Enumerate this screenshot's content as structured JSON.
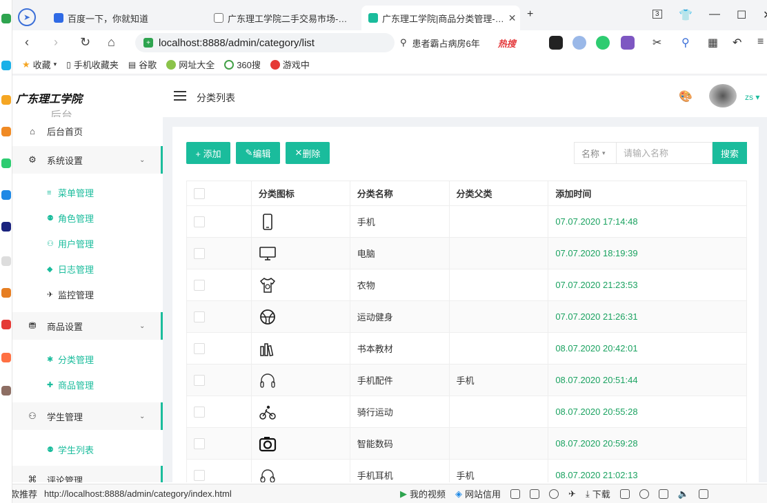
{
  "browser": {
    "tabs": [
      {
        "label": "百度一下，你就知道"
      },
      {
        "label": "广东理工学院二手交易市场-…"
      },
      {
        "label": "广东理工学院|商品分类管理-…"
      }
    ],
    "tab_count_badge": "3",
    "url": "localhost:8888/admin/category/list",
    "search_text": "患者霸占病房6年",
    "search_hot": "热搜",
    "bookmarks": [
      {
        "label": "收藏"
      },
      {
        "label": "手机收藏夹"
      },
      {
        "label": "谷歌"
      },
      {
        "label": "网址大全"
      },
      {
        "label": "360搜"
      },
      {
        "label": "游戏中"
      }
    ]
  },
  "header": {
    "logo": "广东理工学院",
    "logo_sub": "后台管理系统",
    "breadcrumb": "分类列表",
    "username": "zs"
  },
  "sidebar": {
    "menus": [
      {
        "label": "后台首页",
        "icon": "home-icon"
      },
      {
        "label": "系统设置",
        "icon": "gear-icon",
        "subs": [
          {
            "label": "菜单管理"
          },
          {
            "label": "角色管理"
          },
          {
            "label": "用户管理"
          },
          {
            "label": "日志管理"
          },
          {
            "label": "监控管理"
          }
        ]
      },
      {
        "label": "商品设置",
        "icon": "basket-icon",
        "subs": [
          {
            "label": "分类管理"
          },
          {
            "label": "商品管理"
          }
        ]
      },
      {
        "label": "学生管理",
        "icon": "users-icon",
        "subs": [
          {
            "label": "学生列表"
          }
        ]
      },
      {
        "label": "评论管理",
        "icon": "comment-icon"
      }
    ]
  },
  "toolbar": {
    "add_label": "+ 添加",
    "edit_label": "编辑",
    "delete_label": "删除",
    "filter_label": "名称",
    "search_placeholder": "请输入名称",
    "search_button": "搜索"
  },
  "table": {
    "headers": [
      "分类图标",
      "分类名称",
      "分类父类",
      "添加时间"
    ],
    "rows": [
      {
        "icon": "phone-icon",
        "name": "手机",
        "parent": "",
        "time": "07.07.2020 17:14:48"
      },
      {
        "icon": "monitor-icon",
        "name": "电脑",
        "parent": "",
        "time": "07.07.2020 18:19:39"
      },
      {
        "icon": "shirt-icon",
        "name": "衣物",
        "parent": "",
        "time": "07.07.2020 21:23:53"
      },
      {
        "icon": "ball-icon",
        "name": "运动健身",
        "parent": "",
        "time": "07.07.2020 21:26:31"
      },
      {
        "icon": "books-icon",
        "name": "书本教材",
        "parent": "",
        "time": "08.07.2020 20:42:01"
      },
      {
        "icon": "headphones-icon",
        "name": "手机配件",
        "parent": "手机",
        "time": "08.07.2020 20:51:44"
      },
      {
        "icon": "bike-icon",
        "name": "骑行运动",
        "parent": "",
        "time": "08.07.2020 20:55:28"
      },
      {
        "icon": "camera-icon",
        "name": "智能数码",
        "parent": "",
        "time": "08.07.2020 20:59:28"
      },
      {
        "icon": "earphone-icon",
        "name": "手机耳机",
        "parent": "手机",
        "time": "08.07.2020 21:02:13"
      }
    ]
  },
  "statusbar": {
    "lead": "爆款推荐",
    "url": "http://localhost:8888/admin/category/index.html",
    "items": [
      {
        "label": "我的视频"
      },
      {
        "label": "网站信用"
      },
      {
        "label": "下载"
      }
    ]
  }
}
